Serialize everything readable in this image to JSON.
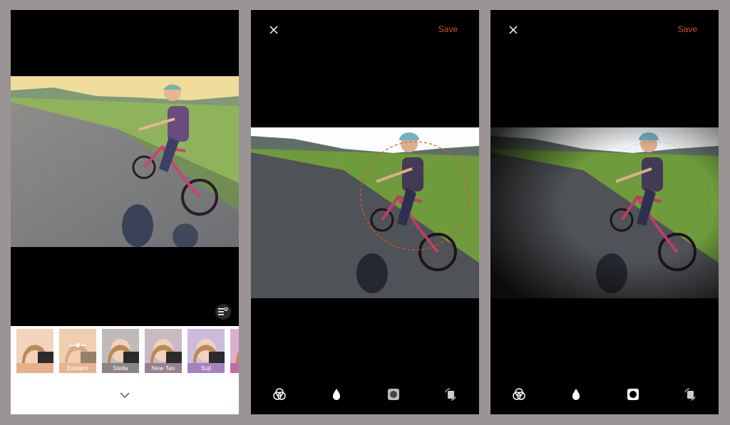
{
  "filter_screen": {
    "filters": [
      {
        "label": "",
        "color": "#e7b08a",
        "selected": false
      },
      {
        "label": "Eastern",
        "color": "#e5b48e",
        "selected": true
      },
      {
        "label": "Stella",
        "color": "#8d8285"
      },
      {
        "label": "New Tan",
        "color": "#9a7f90"
      },
      {
        "label": "Suji",
        "color": "#a383bf"
      },
      {
        "label": "",
        "color": "#c16aa6"
      }
    ],
    "adjust_icon": "sliders-icon",
    "collapse_icon": "chevron-down-icon"
  },
  "editor_radial": {
    "close_icon": "close-icon",
    "save_label": "Save",
    "tools": [
      "color-mix-icon",
      "drop-icon",
      "vignette-icon",
      "rotate-icon"
    ],
    "active_tool": "vignette-icon"
  },
  "editor_vignette": {
    "close_icon": "close-icon",
    "save_label": "Save",
    "tools": [
      "color-mix-icon",
      "drop-icon",
      "vignette-icon",
      "rotate-icon"
    ],
    "active_tool": "vignette-icon"
  },
  "colors": {
    "accent": "#d0502c",
    "background": "#9a9494"
  }
}
